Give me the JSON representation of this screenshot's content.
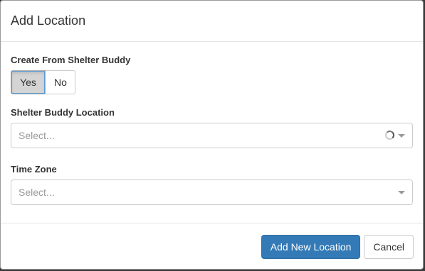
{
  "modal": {
    "title": "Add Location"
  },
  "form": {
    "create_from_label": "Create From Shelter Buddy",
    "toggle": {
      "yes_label": "Yes",
      "no_label": "No",
      "selected": "Yes"
    },
    "shelter_location": {
      "label": "Shelter Buddy Location",
      "placeholder": "Select...",
      "loading": true
    },
    "time_zone": {
      "label": "Time Zone",
      "placeholder": "Select..."
    }
  },
  "footer": {
    "add_label": "Add New Location",
    "cancel_label": "Cancel"
  },
  "colors": {
    "primary": "#337ab7",
    "border": "#cccccc",
    "toggle_active": "#d4d4d4"
  },
  "icons": {
    "spinner": "loading-spinner-icon",
    "caret": "chevron-down-icon"
  }
}
